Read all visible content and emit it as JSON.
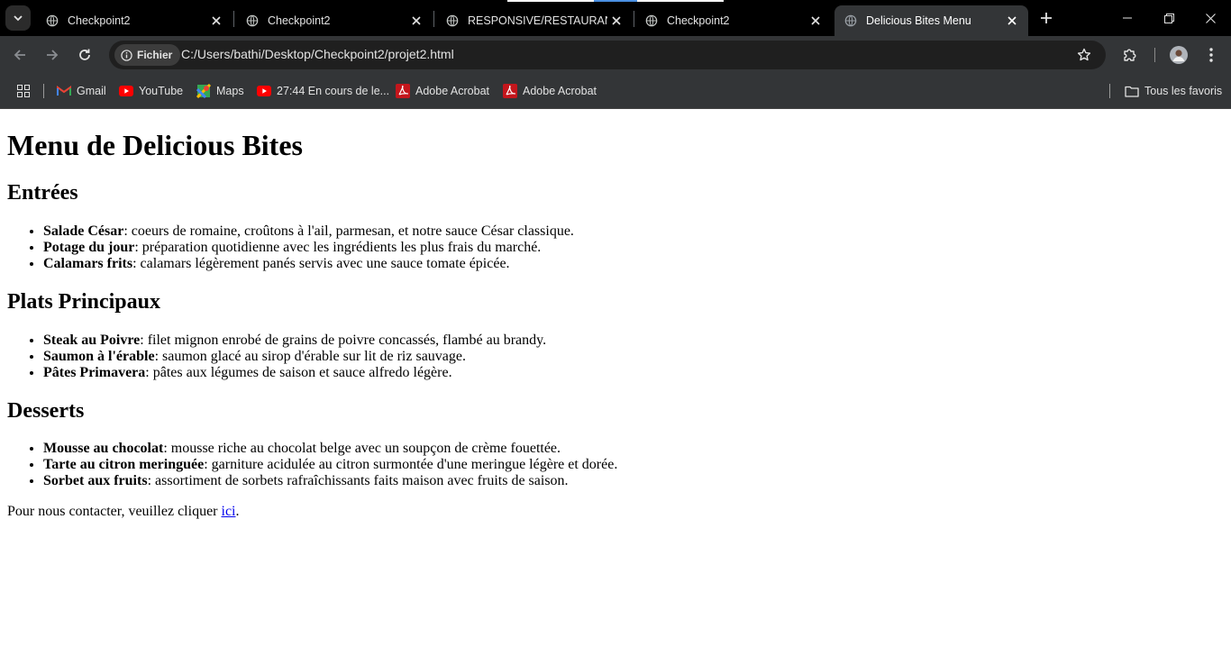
{
  "browser": {
    "tabs": [
      {
        "title": "Checkpoint2",
        "favicon": "globe-icon",
        "active": false
      },
      {
        "title": "Checkpoint2",
        "favicon": "globe-icon",
        "active": false
      },
      {
        "title": "RESPONSIVE/RESTAURANT",
        "favicon": "globe-icon",
        "active": false
      },
      {
        "title": "Checkpoint2",
        "favicon": "globe-icon",
        "active": false
      },
      {
        "title": "Delicious Bites Menu",
        "favicon": "globe-icon",
        "active": true
      }
    ],
    "security_chip": "Fichier",
    "url": "C:/Users/bathi/Desktop/Checkpoint2/projet2.html",
    "bookmarks": [
      {
        "label": "Gmail",
        "icon": "gmail-icon"
      },
      {
        "label": "YouTube",
        "icon": "youtube-icon"
      },
      {
        "label": "Maps",
        "icon": "maps-icon"
      },
      {
        "label": "27:44 En cours de le...",
        "icon": "youtube-icon"
      },
      {
        "label": "Adobe Acrobat",
        "icon": "acrobat-icon"
      },
      {
        "label": "Adobe Acrobat",
        "icon": "acrobat-icon"
      }
    ],
    "all_bookmarks_label": "Tous les favoris",
    "colors": {
      "tabstrip": "#000000",
      "toolbar": "#333537",
      "omnibox": "#1f1f1f"
    }
  },
  "page": {
    "title": "Menu de Delicious Bites",
    "sections": [
      {
        "heading": "Entrées",
        "items": [
          {
            "name": "Salade César",
            "desc": ": coeurs de romaine, croûtons à l'ail, parmesan, et notre sauce César classique."
          },
          {
            "name": "Potage du jour",
            "desc": ": préparation quotidienne avec les ingrédients les plus frais du marché."
          },
          {
            "name": "Calamars frits",
            "desc": ": calamars légèrement panés servis avec une sauce tomate épicée."
          }
        ]
      },
      {
        "heading": "Plats Principaux",
        "items": [
          {
            "name": "Steak au Poivre",
            "desc": ": filet mignon enrobé de grains de poivre concassés, flambé au brandy."
          },
          {
            "name": "Saumon à l'érable",
            "desc": ": saumon glacé au sirop d'érable sur lit de riz sauvage."
          },
          {
            "name": "Pâtes Primavera",
            "desc": ": pâtes aux légumes de saison et sauce alfredo légère."
          }
        ]
      },
      {
        "heading": "Desserts",
        "items": [
          {
            "name": "Mousse au chocolat",
            "desc": ": mousse riche au chocolat belge avec un soupçon de crème fouettée."
          },
          {
            "name": "Tarte au citron meringuée",
            "desc": ": garniture acidulée au citron surmontée d'une meringue légère et dorée."
          },
          {
            "name": "Sorbet aux fruits",
            "desc": ": assortiment de sorbets rafraîchissants faits maison avec fruits de saison."
          }
        ]
      }
    ],
    "contact": {
      "text": "Pour nous contacter, veuillez cliquer ",
      "link": "ici",
      "end": "."
    },
    "colors": {
      "link": "#0000ee"
    }
  }
}
